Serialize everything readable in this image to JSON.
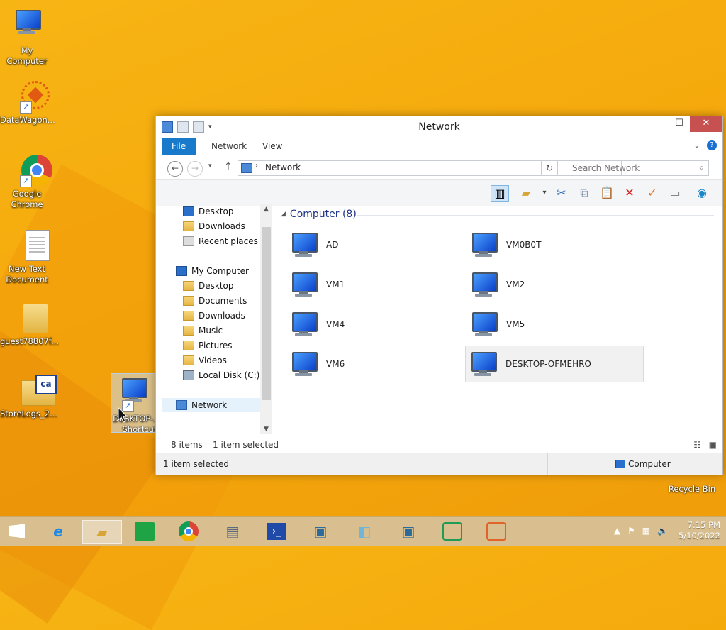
{
  "desktop": {
    "icons": [
      {
        "label": "My Computer"
      },
      {
        "label": "DataWagon..."
      },
      {
        "label": "Google Chrome"
      },
      {
        "label": "New Text Document"
      },
      {
        "label": "guest78807f..."
      },
      {
        "label": "StoreLogs_2..."
      },
      {
        "label": "DESKTOP-... - Shortcut"
      },
      {
        "label": "Recycle Bin"
      }
    ]
  },
  "window": {
    "title": "Network",
    "tabs": [
      "File",
      "Network",
      "View"
    ],
    "address": "Network",
    "search_placeholder": "Search Network",
    "nav": {
      "quick": [
        "Desktop",
        "Downloads",
        "Recent places"
      ],
      "computer": "My Computer",
      "computer_items": [
        "Desktop",
        "Documents",
        "Downloads",
        "Music",
        "Pictures",
        "Videos",
        "Local Disk (C:)"
      ],
      "network": "Network"
    },
    "group_header": "Computer (8)",
    "items": [
      "AD",
      "VM0B0T",
      "VM1",
      "VM2",
      "VM4",
      "VM5",
      "VM6",
      "DESKTOP-OFMEHRO"
    ],
    "status_count": "8 items",
    "status_selected": "1 item selected",
    "statusbar_left": "1 item selected",
    "statusbar_right": "Computer"
  },
  "taskbar": {
    "time": "7:15 PM",
    "date": "5/10/2022"
  },
  "colors": {
    "accent": "#1979ca",
    "desktop": "#f5a90c",
    "close": "#c75050"
  }
}
